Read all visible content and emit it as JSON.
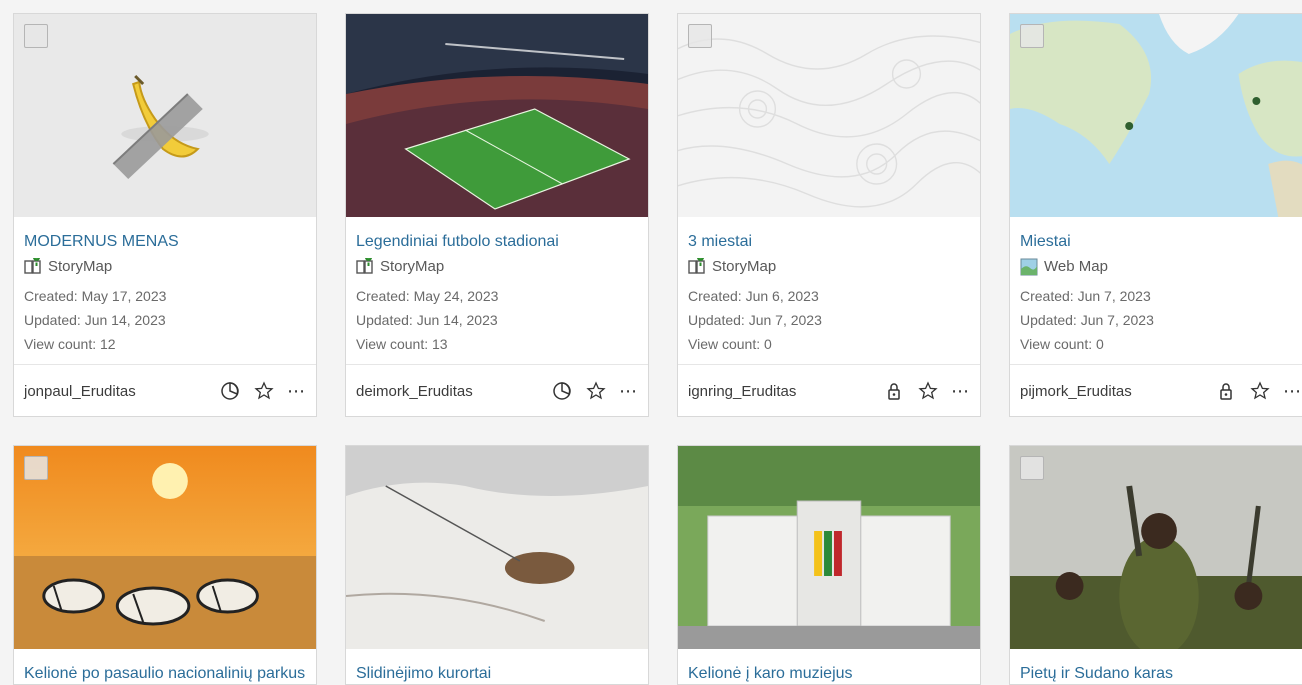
{
  "cards": [
    {
      "title": "MODERNUS MENAS",
      "type": "StoryMap",
      "created": "Created: May 17, 2023",
      "updated": "Updated: Jun 14, 2023",
      "views": "View count: 12",
      "owner": "jonpaul_Eruditas",
      "share_icon": "shared-organization-icon"
    },
    {
      "title": "Legendiniai futbolo stadionai",
      "type": "StoryMap",
      "created": "Created: May 24, 2023",
      "updated": "Updated: Jun 14, 2023",
      "views": "View count: 13",
      "owner": "deimork_Eruditas",
      "share_icon": "shared-organization-icon"
    },
    {
      "title": "3 miestai",
      "type": "StoryMap",
      "created": "Created: Jun 6, 2023",
      "updated": "Updated: Jun 7, 2023",
      "views": "View count: 0",
      "owner": "ignring_Eruditas",
      "share_icon": "private-lock-icon"
    },
    {
      "title": "Miestai",
      "type": "Web Map",
      "created": "Created: Jun 7, 2023",
      "updated": "Updated: Jun 7, 2023",
      "views": "View count: 0",
      "owner": "pijmork_Eruditas",
      "share_icon": "private-lock-icon"
    },
    {
      "title": "Kelionė po pasaulio nacionalinių parkus"
    },
    {
      "title": "Slidinėjimo kurortai"
    },
    {
      "title": "Kelionė į karo muziejus"
    },
    {
      "title": "Pietų ir Sudano karas"
    }
  ],
  "colors": {
    "title_link": "#2b6d99",
    "meta_text": "#6a6a6a",
    "background": "#f4f4f4"
  }
}
